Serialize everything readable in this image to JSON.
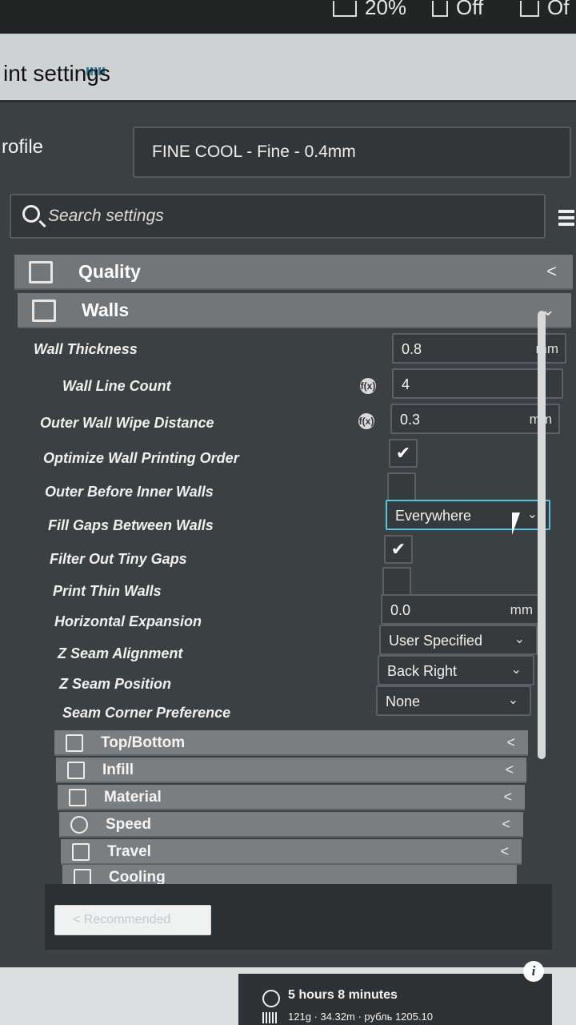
{
  "topbar": {
    "infill_value": "20%",
    "support_value": "Off",
    "adhesion_value": "Of"
  },
  "window": {
    "title": "int settings"
  },
  "profile": {
    "label": "rofile",
    "value": "FINE COOL - Fine - 0.4mm"
  },
  "search": {
    "placeholder": "Search settings"
  },
  "categories": {
    "quality": {
      "label": "Quality",
      "chevron": "<"
    },
    "walls": {
      "label": "Walls",
      "chevron": "⌄"
    }
  },
  "walls": {
    "wall_thickness": {
      "label": "Wall Thickness",
      "value": "0.8",
      "unit": "mm"
    },
    "wall_line_count": {
      "label": "Wall Line Count",
      "value": "4"
    },
    "outer_wall_wipe_distance": {
      "label": "Outer Wall Wipe Distance",
      "value": "0.3",
      "unit": "mm"
    },
    "optimize_wall_printing_order": {
      "label": "Optimize Wall Printing Order",
      "checked": true
    },
    "outer_before_inner_walls": {
      "label": "Outer Before Inner Walls",
      "checked": false
    },
    "fill_gaps_between_walls": {
      "label": "Fill Gaps Between Walls",
      "value": "Everywhere"
    },
    "filter_out_tiny_gaps": {
      "label": "Filter Out Tiny Gaps",
      "checked": true
    },
    "print_thin_walls": {
      "label": "Print Thin Walls",
      "checked": false
    },
    "horizontal_expansion": {
      "label": "Horizontal Expansion",
      "value": "0.0",
      "unit": "mm"
    },
    "z_seam_alignment": {
      "label": "Z Seam Alignment",
      "value": "User Specified"
    },
    "z_seam_position": {
      "label": "Z Seam Position",
      "value": "Back Right"
    },
    "seam_corner_preference": {
      "label": "Seam Corner Preference",
      "value": "None"
    }
  },
  "sub_categories": [
    {
      "label": "Top/Bottom",
      "icon": "top-bottom-icon"
    },
    {
      "label": "Infill",
      "icon": "infill-icon"
    },
    {
      "label": "Material",
      "icon": "material-icon"
    },
    {
      "label": "Speed",
      "icon": "speed-icon"
    },
    {
      "label": "Travel",
      "icon": "travel-icon"
    },
    {
      "label": "Cooling",
      "icon": "cooling-icon"
    }
  ],
  "footer": {
    "recommended_label": "< Recommended"
  },
  "estimate": {
    "time": "5 hours 8 minutes",
    "material": "121g · 34.32m · рубль 1205.10"
  },
  "glyphs": {
    "check": "✔",
    "dropdown": "⌄",
    "collapsed": "<",
    "info": "i",
    "reset": "f(x)"
  }
}
